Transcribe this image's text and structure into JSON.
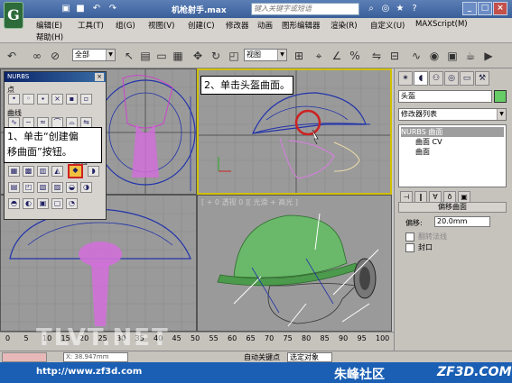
{
  "window": {
    "title": "机枪射手.max",
    "help_placeholder": "键入关键字或短语",
    "logo": "G"
  },
  "menu": [
    "编辑(E)",
    "工具(T)",
    "组(G)",
    "视图(V)",
    "创建(C)",
    "修改器",
    "动画",
    "图形编辑器",
    "渲染(R)",
    "自定义(U)",
    "MAXScript(M)",
    "帮助(H)"
  ],
  "toolbar": {
    "selection_set": "全部",
    "ref_coord": "视图"
  },
  "nurbs_panel": {
    "title": "NURBS",
    "section_point": "点",
    "section_curve": "曲线",
    "section_surface": "曲面"
  },
  "callouts": {
    "step1": [
      "1、单击“创建偏",
      "移曲面”按钮。"
    ],
    "step2": "2、单击头盔曲面。"
  },
  "viewports": {
    "perspective_label": "[ + 0 透视 0 ][ 光滑 + 高光 ]"
  },
  "command_panel": {
    "object_name": "头盔",
    "modifier_list": "修改器列表",
    "stack": [
      "NURBS 曲面",
      "曲面 CV",
      "曲面"
    ],
    "rollout_title": "偏移曲面",
    "offset_label": "偏移:",
    "offset_value": "20.0mm",
    "flip_normals": "翻转法线",
    "cap": "封口"
  },
  "timeline": {
    "ticks": [
      "0",
      "5",
      "10",
      "15",
      "20",
      "25",
      "30",
      "35",
      "40",
      "45",
      "50",
      "55",
      "60",
      "65",
      "70",
      "75",
      "80",
      "85",
      "90",
      "95",
      "100"
    ]
  },
  "status": {
    "coord": "X: 38.947mm",
    "autokey": "自动关键点",
    "filter": "选定对象"
  },
  "footer": {
    "url": "http://www.zf3d.com",
    "brand": "朱峰社区",
    "site": "ZF3D.COM",
    "watermark": "TLVT.NET"
  },
  "colors": {
    "highlight": "#d0c000",
    "helmet": "#66b266",
    "callout_ring": "#cc2222",
    "footer": "#1a5fb4"
  }
}
